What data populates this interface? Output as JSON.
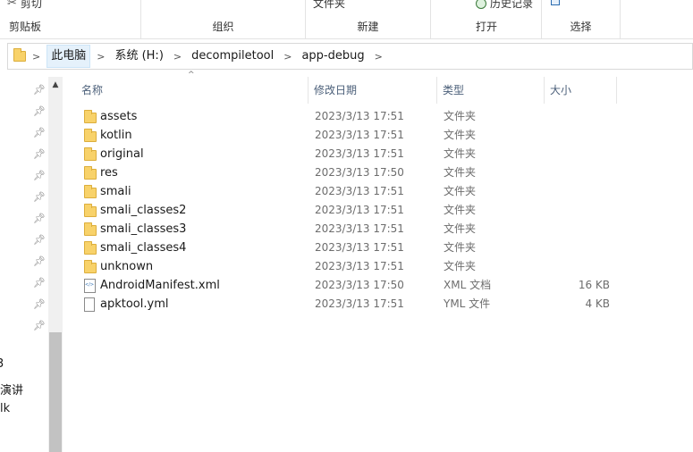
{
  "ribbon": {
    "cut_label": "剪切",
    "clipboard_label": "剪贴板",
    "organize_label": "组织",
    "new_folder_label": "文件夹",
    "new_label": "新建",
    "history_label": "历史记录",
    "open_label": "打开",
    "select_label": "选择"
  },
  "address": {
    "crumbs": [
      "此电脑",
      "系统 (H:)",
      "decompiletool",
      "app-debug"
    ]
  },
  "nav": {
    "pins": 12,
    "clipped_items": [
      "3",
      "演讲",
      "lk"
    ]
  },
  "columns": {
    "name": "名称",
    "date": "修改日期",
    "type": "类型",
    "size": "大小"
  },
  "files": [
    {
      "name": "assets",
      "date": "2023/3/13 17:51",
      "type": "文件夹",
      "size": "",
      "icon": "folder-icon"
    },
    {
      "name": "kotlin",
      "date": "2023/3/13 17:51",
      "type": "文件夹",
      "size": "",
      "icon": "folder-icon"
    },
    {
      "name": "original",
      "date": "2023/3/13 17:51",
      "type": "文件夹",
      "size": "",
      "icon": "folder-icon"
    },
    {
      "name": "res",
      "date": "2023/3/13 17:50",
      "type": "文件夹",
      "size": "",
      "icon": "folder-icon"
    },
    {
      "name": "smali",
      "date": "2023/3/13 17:51",
      "type": "文件夹",
      "size": "",
      "icon": "folder-icon"
    },
    {
      "name": "smali_classes2",
      "date": "2023/3/13 17:51",
      "type": "文件夹",
      "size": "",
      "icon": "folder-icon"
    },
    {
      "name": "smali_classes3",
      "date": "2023/3/13 17:51",
      "type": "文件夹",
      "size": "",
      "icon": "folder-icon"
    },
    {
      "name": "smali_classes4",
      "date": "2023/3/13 17:51",
      "type": "文件夹",
      "size": "",
      "icon": "folder-icon"
    },
    {
      "name": "unknown",
      "date": "2023/3/13 17:51",
      "type": "文件夹",
      "size": "",
      "icon": "folder-icon"
    },
    {
      "name": "AndroidManifest.xml",
      "date": "2023/3/13 17:50",
      "type": "XML 文档",
      "size": "16 KB",
      "icon": "xml-file-icon"
    },
    {
      "name": "apktool.yml",
      "date": "2023/3/13 17:51",
      "type": "YML 文件",
      "size": "4 KB",
      "icon": "file-icon"
    }
  ]
}
